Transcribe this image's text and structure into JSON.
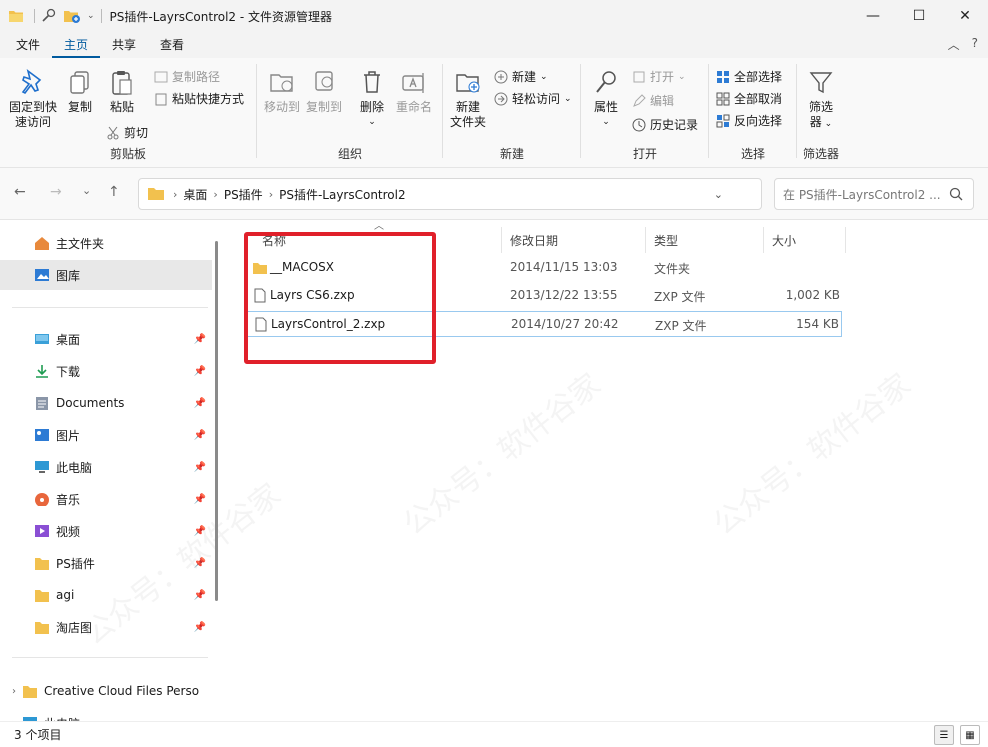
{
  "window": {
    "title": "PS插件-LayrsControl2 - 文件资源管理器",
    "controls": {
      "minimize": "—",
      "maximize": "☐",
      "close": "✕"
    }
  },
  "ribbon_tabs": [
    "文件",
    "主页",
    "共享",
    "查看"
  ],
  "ribbon_right": {
    "collapse": "︿",
    "help": "?"
  },
  "ribbon": {
    "clipboard": {
      "label": "剪贴板",
      "pin": "固定到快\n速访问",
      "pin_line1": "固定到快",
      "pin_line2": "速访问",
      "copy": "复制",
      "paste": "粘贴",
      "copy_path": "复制路径",
      "paste_shortcut": "粘贴快捷方式",
      "cut": "剪切"
    },
    "organize": {
      "label": "组织",
      "move_to": "移动到",
      "copy_to": "复制到",
      "delete": "删除",
      "rename": "重命名"
    },
    "new": {
      "label": "新建",
      "new_item": "新建",
      "easy_access": "轻松访问",
      "new_folder_line1": "新建",
      "new_folder_line2": "文件夹"
    },
    "open": {
      "label": "打开",
      "properties": "属性",
      "open": "打开",
      "edit": "编辑",
      "history": "历史记录"
    },
    "select": {
      "label": "选择",
      "select_all": "全部选择",
      "select_none": "全部取消",
      "invert": "反向选择"
    },
    "filter": {
      "label": "筛选器",
      "filter_line1": "筛选",
      "filter_line2": "器"
    }
  },
  "address": {
    "breadcrumbs": [
      "桌面",
      "PS插件",
      "PS插件-LayrsControl2"
    ],
    "search_placeholder": "在 PS插件-LayrsControl2 ..."
  },
  "nav_pane": {
    "top": [
      {
        "label": "主文件夹",
        "icon": "home-icon"
      },
      {
        "label": "图库",
        "icon": "gallery-icon"
      }
    ],
    "quick": [
      {
        "label": "桌面",
        "icon": "desktop-icon"
      },
      {
        "label": "下载",
        "icon": "download-icon"
      },
      {
        "label": "Documents",
        "icon": "document-icon"
      },
      {
        "label": "图片",
        "icon": "pictures-icon"
      },
      {
        "label": "此电脑",
        "icon": "computer-icon"
      },
      {
        "label": "音乐",
        "icon": "music-icon"
      },
      {
        "label": "视频",
        "icon": "video-icon"
      },
      {
        "label": "PS插件",
        "icon": "folder-icon"
      },
      {
        "label": "agi",
        "icon": "folder-icon"
      },
      {
        "label": "淘店图",
        "icon": "folder-icon"
      }
    ],
    "bottom": [
      {
        "label": "Creative Cloud Files Personal",
        "icon": "folder-icon"
      },
      {
        "label": "此电脑",
        "icon": "computer-icon"
      }
    ]
  },
  "columns": [
    "名称",
    "修改日期",
    "类型",
    "大小"
  ],
  "files": [
    {
      "name": "__MACOSX",
      "date": "2014/11/15 13:03",
      "type": "文件夹",
      "size": "",
      "icon": "folder-icon"
    },
    {
      "name": "Layrs CS6.zxp",
      "date": "2013/12/22 13:55",
      "type": "ZXP 文件",
      "size": "1,002 KB",
      "icon": "file-icon"
    },
    {
      "name": "LayrsControl_2.zxp",
      "date": "2014/10/27 20:42",
      "type": "ZXP 文件",
      "size": "154 KB",
      "icon": "file-icon"
    }
  ],
  "status": {
    "count": "3 个项目"
  },
  "watermark": "公众号：软件谷家",
  "colors": {
    "accent": "#005a9e",
    "highlight_box": "#e0202a",
    "folder": "#f2c14e"
  }
}
